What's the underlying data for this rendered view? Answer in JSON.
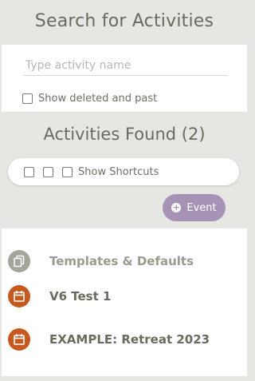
{
  "search": {
    "title": "Search for Activities",
    "placeholder": "Type activity name",
    "value": "",
    "show_deleted_label": "Show deleted and past"
  },
  "results": {
    "title": "Activities Found (2)",
    "shortcuts_label": "Show Shortcuts",
    "event_button_label": "Event"
  },
  "list": {
    "items": [
      {
        "label": "Templates & Defaults",
        "icon": "copy-icon",
        "color": "#a5a59c",
        "text_color": "#9a9a90"
      },
      {
        "label": "V6 Test 1",
        "icon": "calendar-icon",
        "color": "#c65a1e",
        "text_color": "#6a6a5f"
      },
      {
        "label": "EXAMPLE: Retreat 2023",
        "icon": "calendar-icon",
        "color": "#c65a1e",
        "text_color": "#6a6a5f"
      }
    ]
  },
  "colors": {
    "background": "#e6e6e2",
    "accent_purple": "#a592b5",
    "calendar_orange": "#c65a1e"
  }
}
